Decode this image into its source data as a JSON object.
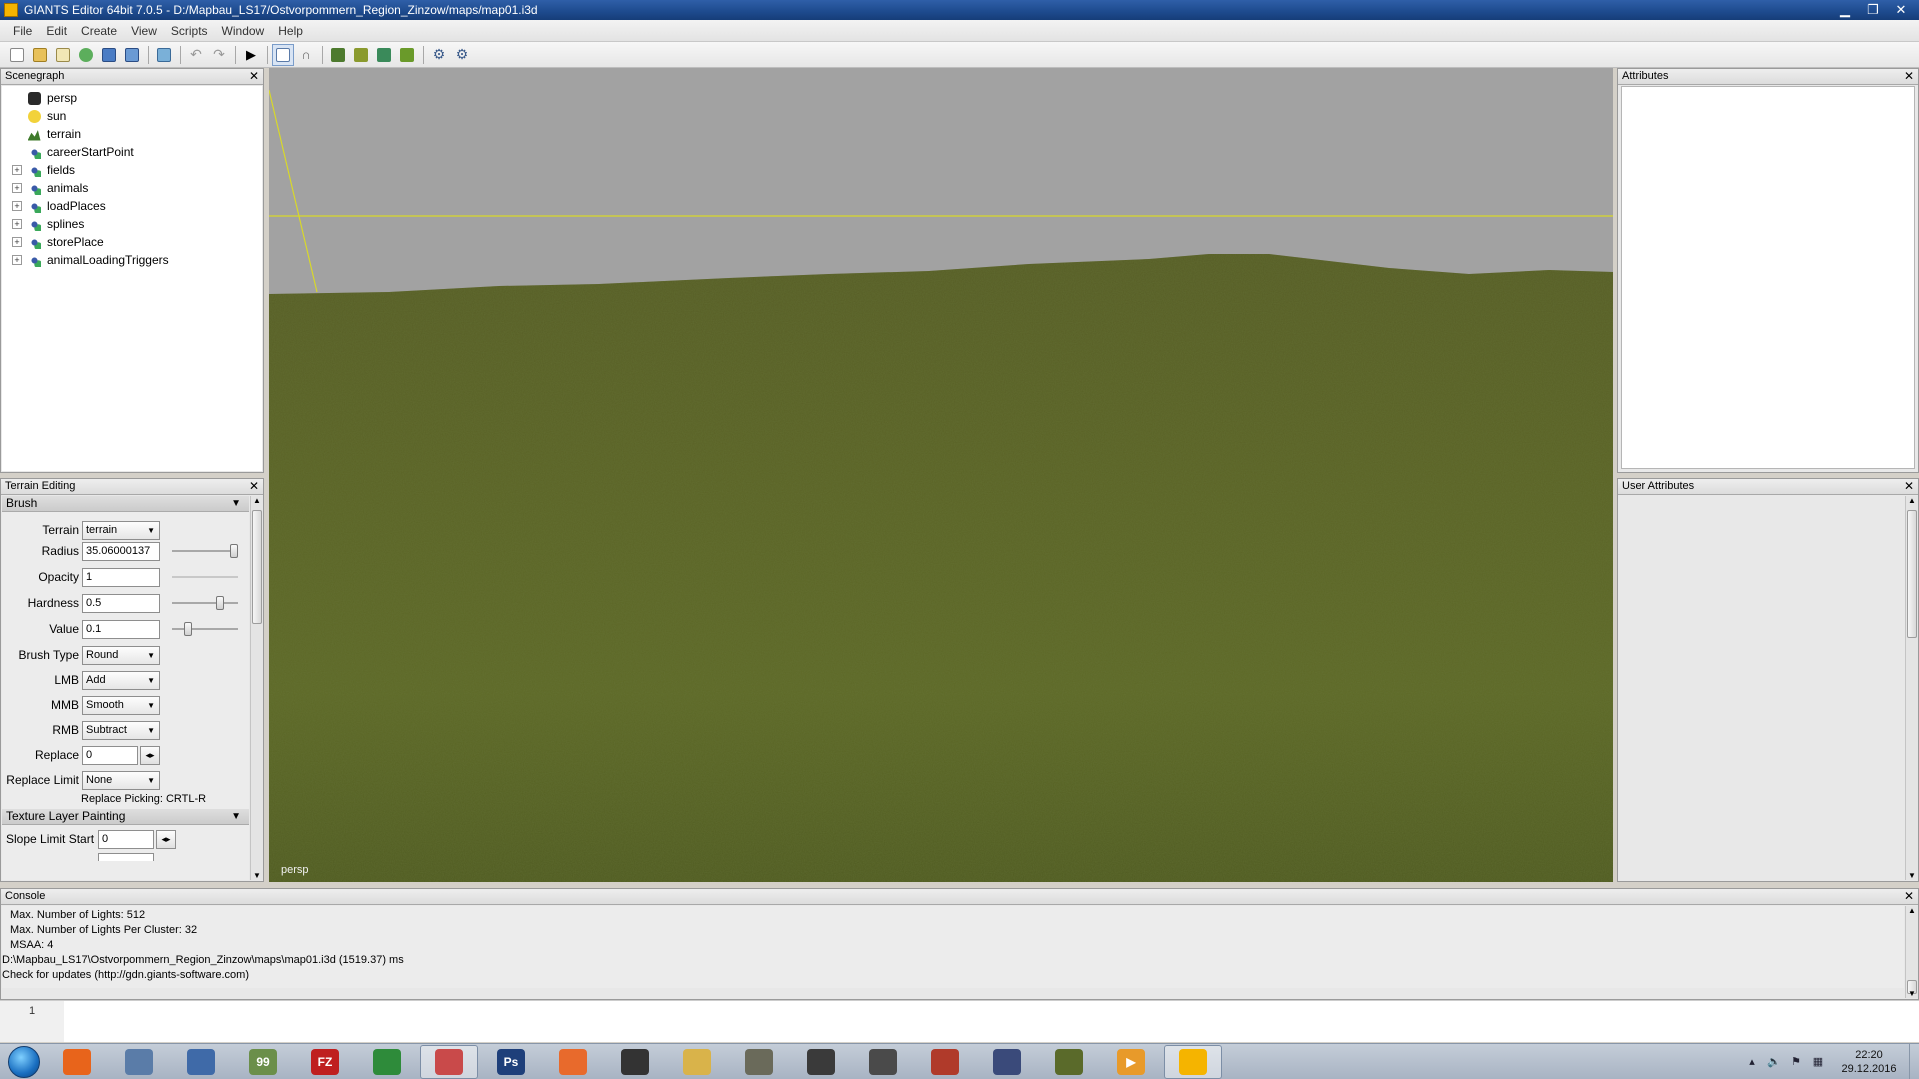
{
  "window": {
    "title": "GIANTS Editor 64bit 7.0.5 - D:/Mapbau_LS17/Ostvorpommern_Region_Zinzow/maps/map01.i3d",
    "minimize": "▁",
    "maximize": "❐",
    "close": "✕"
  },
  "menu": [
    "File",
    "Edit",
    "Create",
    "View",
    "Scripts",
    "Window",
    "Help"
  ],
  "scenegraph": {
    "title": "Scenegraph",
    "close": "✕",
    "nodes": [
      {
        "label": "persp",
        "expandable": false,
        "icon": "camera-icon"
      },
      {
        "label": "sun",
        "expandable": false,
        "icon": "light-bulb-icon"
      },
      {
        "label": "terrain",
        "expandable": false,
        "icon": "terrain-icon"
      },
      {
        "label": "careerStartPoint",
        "expandable": false,
        "icon": "transform-group-icon"
      },
      {
        "label": "fields",
        "expandable": true,
        "icon": "transform-group-icon"
      },
      {
        "label": "animals",
        "expandable": true,
        "icon": "transform-group-icon"
      },
      {
        "label": "loadPlaces",
        "expandable": true,
        "icon": "transform-group-icon"
      },
      {
        "label": "splines",
        "expandable": true,
        "icon": "transform-group-icon"
      },
      {
        "label": "storePlace",
        "expandable": true,
        "icon": "transform-group-icon"
      },
      {
        "label": "animalLoadingTriggers",
        "expandable": true,
        "icon": "transform-group-icon"
      }
    ]
  },
  "terrain_editing": {
    "title": "Terrain Editing",
    "close": "✕",
    "brush_section": "Brush",
    "section_arrow": "▼",
    "terrain_label": "Terrain",
    "terrain_value": "terrain",
    "radius_label": "Radius",
    "radius_value": "35.06000137",
    "radius_level": 1.0,
    "opacity_label": "Opacity",
    "opacity_value": "1",
    "hardness_label": "Hardness",
    "hardness_value": "0.5",
    "hardness_level": 0.75,
    "value_label": "Value",
    "value_value": "0.1",
    "value_level": 0.2,
    "brush_type_label": "Brush Type",
    "brush_type_value": "Round",
    "lmb_label": "LMB",
    "lmb_value": "Add",
    "mmb_label": "MMB",
    "mmb_value": "Smooth",
    "rmb_label": "RMB",
    "rmb_value": "Subtract",
    "replace_label": "Replace",
    "replace_value": "0",
    "replace_limit_label": "Replace Limit",
    "replace_limit_value": "None",
    "replace_picking_hint": "Replace Picking: CRTL-R",
    "texture_section": "Texture Layer Painting",
    "slope_start_label": "Slope Limit Start",
    "slope_start_value": "0",
    "stepper_glyph": "◂▸"
  },
  "viewport": {
    "camera_label": "persp"
  },
  "attributes": {
    "title": "Attributes",
    "close": "✕"
  },
  "user_attributes": {
    "title": "User Attributes",
    "close": "✕"
  },
  "console": {
    "title": "Console",
    "close": "✕",
    "lines": [
      {
        "text": "Max. Number of Lights: 512",
        "indent": true
      },
      {
        "text": "Max. Number of Lights Per Cluster: 32",
        "indent": true
      },
      {
        "text": "MSAA: 4",
        "indent": true
      },
      {
        "text": "D:\\Mapbau_LS17\\Ostvorpommern_Region_Zinzow\\maps\\map01.i3d (1519.37) ms",
        "indent": false
      },
      {
        "text": "Check for updates (http://gdn.giants-software.com)",
        "indent": false
      }
    ],
    "line_number": "1"
  },
  "taskbar": {
    "apps": [
      {
        "name": "firefox-icon",
        "color": "#e8641b",
        "glyph": ""
      },
      {
        "name": "app-icon-2",
        "color": "#5a7ca8",
        "glyph": ""
      },
      {
        "name": "app-icon-3",
        "color": "#3f6aa8",
        "glyph": ""
      },
      {
        "name": "app-icon-4",
        "color": "#6b8f4a",
        "glyph": "99"
      },
      {
        "name": "filezilla-icon",
        "color": "#bf1f1f",
        "glyph": "FZ"
      },
      {
        "name": "app-icon-6",
        "color": "#2e8b3a",
        "glyph": ""
      },
      {
        "name": "app-icon-7",
        "color": "#c94a4a",
        "glyph": "",
        "active": true
      },
      {
        "name": "photoshop-icon",
        "color": "#1e3f7a",
        "glyph": "Ps"
      },
      {
        "name": "app-icon-9",
        "color": "#e86a2c",
        "glyph": ""
      },
      {
        "name": "app-icon-10",
        "color": "#333333",
        "glyph": ""
      },
      {
        "name": "explorer-icon",
        "color": "#d9b34a",
        "glyph": ""
      },
      {
        "name": "gimp-icon",
        "color": "#6a6a5a",
        "glyph": ""
      },
      {
        "name": "app-icon-13",
        "color": "#3a3a3a",
        "glyph": ""
      },
      {
        "name": "tractor-icon",
        "color": "#4a4a4a",
        "glyph": ""
      },
      {
        "name": "app-icon-15",
        "color": "#b03a2a",
        "glyph": ""
      },
      {
        "name": "app-icon-16",
        "color": "#3a4a7a",
        "glyph": ""
      },
      {
        "name": "app-icon-17",
        "color": "#5a6a2a",
        "glyph": ""
      },
      {
        "name": "media-player-icon",
        "color": "#e89a2a",
        "glyph": "▶"
      },
      {
        "name": "giants-editor-icon",
        "color": "#f5b400",
        "glyph": "",
        "active": true
      }
    ],
    "clock_time": "22:20",
    "clock_date": "29.12.2016"
  }
}
